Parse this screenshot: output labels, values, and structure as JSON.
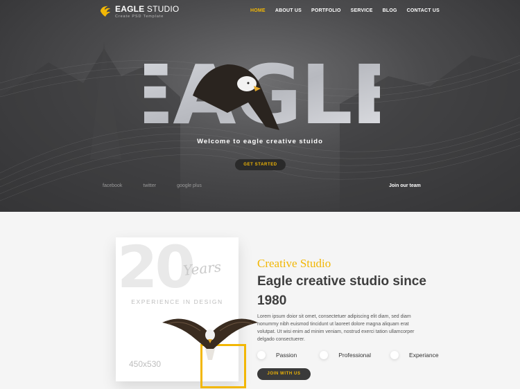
{
  "brand": {
    "title_bold": "EAGLE",
    "title_light": " STUDIO",
    "subtitle": "Create PSD Template",
    "accent": "#f2b705"
  },
  "nav": {
    "items": [
      {
        "label": "HOME",
        "active": true
      },
      {
        "label": "ABOUT US",
        "active": false
      },
      {
        "label": "PORTFOLIO",
        "active": false
      },
      {
        "label": "SERVICE",
        "active": false
      },
      {
        "label": "BLOG",
        "active": false
      },
      {
        "label": "CONTACT US",
        "active": false
      }
    ]
  },
  "hero": {
    "big_word": "EAGLE",
    "welcome": "Welcome to eagle creative stuido",
    "cta": "GET STARTED",
    "social": [
      "facebook",
      "twitter",
      "google plus"
    ],
    "join_team": "Join our team"
  },
  "about": {
    "card": {
      "number": "20",
      "years": "Years",
      "experience": "EXPERIENCE IN DESIGN",
      "size": "450x530"
    },
    "script_title": "Creative Studio",
    "heading": "Eagle creative studio since 1980",
    "paragraph": "Lorem ipsum doior sit omet, consectetuer adipiscing elit diam, sed diam nonummy nibh euismod tincidunt ut laoreet dolore magna aliquam erat volutpat. Ut wisi enim ad minim veniam, nostrud exerci tation ullamcorper delgado consectuerer.",
    "features": [
      "Passion",
      "Professional",
      "Experiance"
    ],
    "join_button": "JOIN WITH US"
  }
}
